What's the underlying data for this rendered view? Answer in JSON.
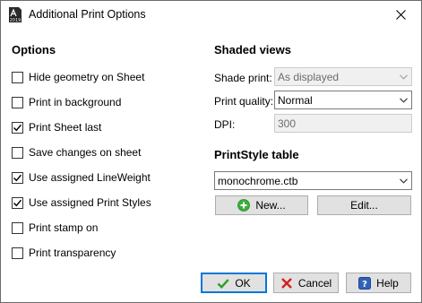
{
  "window": {
    "title": "Additional Print Options",
    "app_icon": "autocad-2019-icon",
    "app_icon_badge": "2019",
    "close_icon": "close-x-icon"
  },
  "options": {
    "title": "Options",
    "items": [
      {
        "label": "Hide geometry on Sheet",
        "checked": false
      },
      {
        "label": "Print in background",
        "checked": false
      },
      {
        "label": "Print Sheet last",
        "checked": true
      },
      {
        "label": "Save changes on sheet",
        "checked": false
      },
      {
        "label": "Use assigned LineWeight",
        "checked": true
      },
      {
        "label": "Use assigned Print Styles",
        "checked": true
      },
      {
        "label": "Print stamp on",
        "checked": false
      },
      {
        "label": "Print transparency",
        "checked": false
      }
    ]
  },
  "shaded_views": {
    "title": "Shaded views",
    "shade_print_label": "Shade print:",
    "shade_print_value": "As displayed",
    "print_quality_label": "Print quality:",
    "print_quality_value": "Normal",
    "dpi_label": "DPI:",
    "dpi_value": "300"
  },
  "printstyle": {
    "title": "PrintStyle table",
    "value": "monochrome.ctb",
    "new_label": "New...",
    "edit_label": "Edit..."
  },
  "buttons": {
    "ok_label": "OK",
    "cancel_label": "Cancel",
    "help_label": "Help"
  },
  "colors": {
    "accent": "#0078d7",
    "ok_check": "#2a9d2a",
    "cancel_x": "#d42020",
    "new_plus": "#3cae3c",
    "help_blue": "#2f63b8"
  }
}
